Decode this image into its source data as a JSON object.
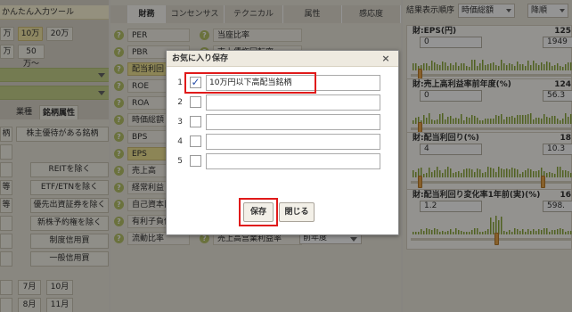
{
  "left": {
    "title": "かんたん入力ツール",
    "amount_row1": [
      "万",
      "10万",
      "20万"
    ],
    "amount_row2": [
      "万",
      "50万〜"
    ],
    "tabs": [
      "業種",
      "銘柄属性"
    ],
    "grid": [
      [
        "柄",
        "株主優待がある銘柄"
      ],
      [
        "",
        ""
      ],
      [
        "",
        "REITを除く"
      ],
      [
        "等",
        "ETF/ETNを除く"
      ],
      [
        "等",
        "優先出資証券を除く"
      ],
      [
        "",
        "新株予約権を除く"
      ],
      [
        "",
        "制度信用買"
      ],
      [
        "",
        "一般信用買"
      ]
    ],
    "months_row1": [
      "",
      "7月",
      "10月"
    ],
    "months_row2": [
      "",
      "8月",
      "11月"
    ]
  },
  "tabs": [
    "財務",
    "コンセンサス",
    "テクニカル",
    "属性",
    "感応度"
  ],
  "mid": {
    "col1": [
      "PER",
      "PBR",
      "配当利回り",
      "ROE",
      "ROA",
      "時価総額",
      "BPS",
      "EPS",
      "売上高",
      "経常利益",
      "自己資本比率",
      "有利子負債",
      "流動比率"
    ],
    "col2_top": [
      "当座比率",
      "売上債権回転率"
    ],
    "col2_bottom": "売上高営業利益率",
    "bottom_select": "前年度"
  },
  "right": {
    "sort_label": "結果表示順序",
    "sort_value": "時価総額",
    "order_value": "降順",
    "cards": [
      {
        "title": "財:EPS(円)",
        "max_label": "125",
        "min": "0",
        "max": "1949"
      },
      {
        "title": "財:売上高利益率前年度(%)",
        "max_label": "124",
        "min": "0",
        "max": "56.3"
      },
      {
        "title": "財:配当利回り(%)",
        "max_label": "18",
        "min": "4",
        "max": "10.3"
      },
      {
        "title": "財:配当利回り変化率1年前(実)(%)",
        "max_label": "16",
        "min": "1.2",
        "max": "598."
      }
    ]
  },
  "modal": {
    "title": "お気に入り保存",
    "close": "×",
    "rows": [
      {
        "num": "1",
        "checked": true,
        "value": "10万円以下高配当銘柄"
      },
      {
        "num": "2",
        "checked": false,
        "value": ""
      },
      {
        "num": "3",
        "checked": false,
        "value": ""
      },
      {
        "num": "4",
        "checked": false,
        "value": ""
      },
      {
        "num": "5",
        "checked": false,
        "value": ""
      }
    ],
    "check_mark": "✓",
    "save_label": "保存",
    "close_label": "閉じる"
  },
  "colors": {
    "accent_green": "#c9d58c",
    "highlight": "#e01a1a",
    "slider": "#e9a54a",
    "histogram": "#8aa83a"
  },
  "icons": {
    "help": "question-circle-icon",
    "dropdown": "chevron-down-icon",
    "close": "close-icon",
    "check": "checkmark-icon"
  }
}
